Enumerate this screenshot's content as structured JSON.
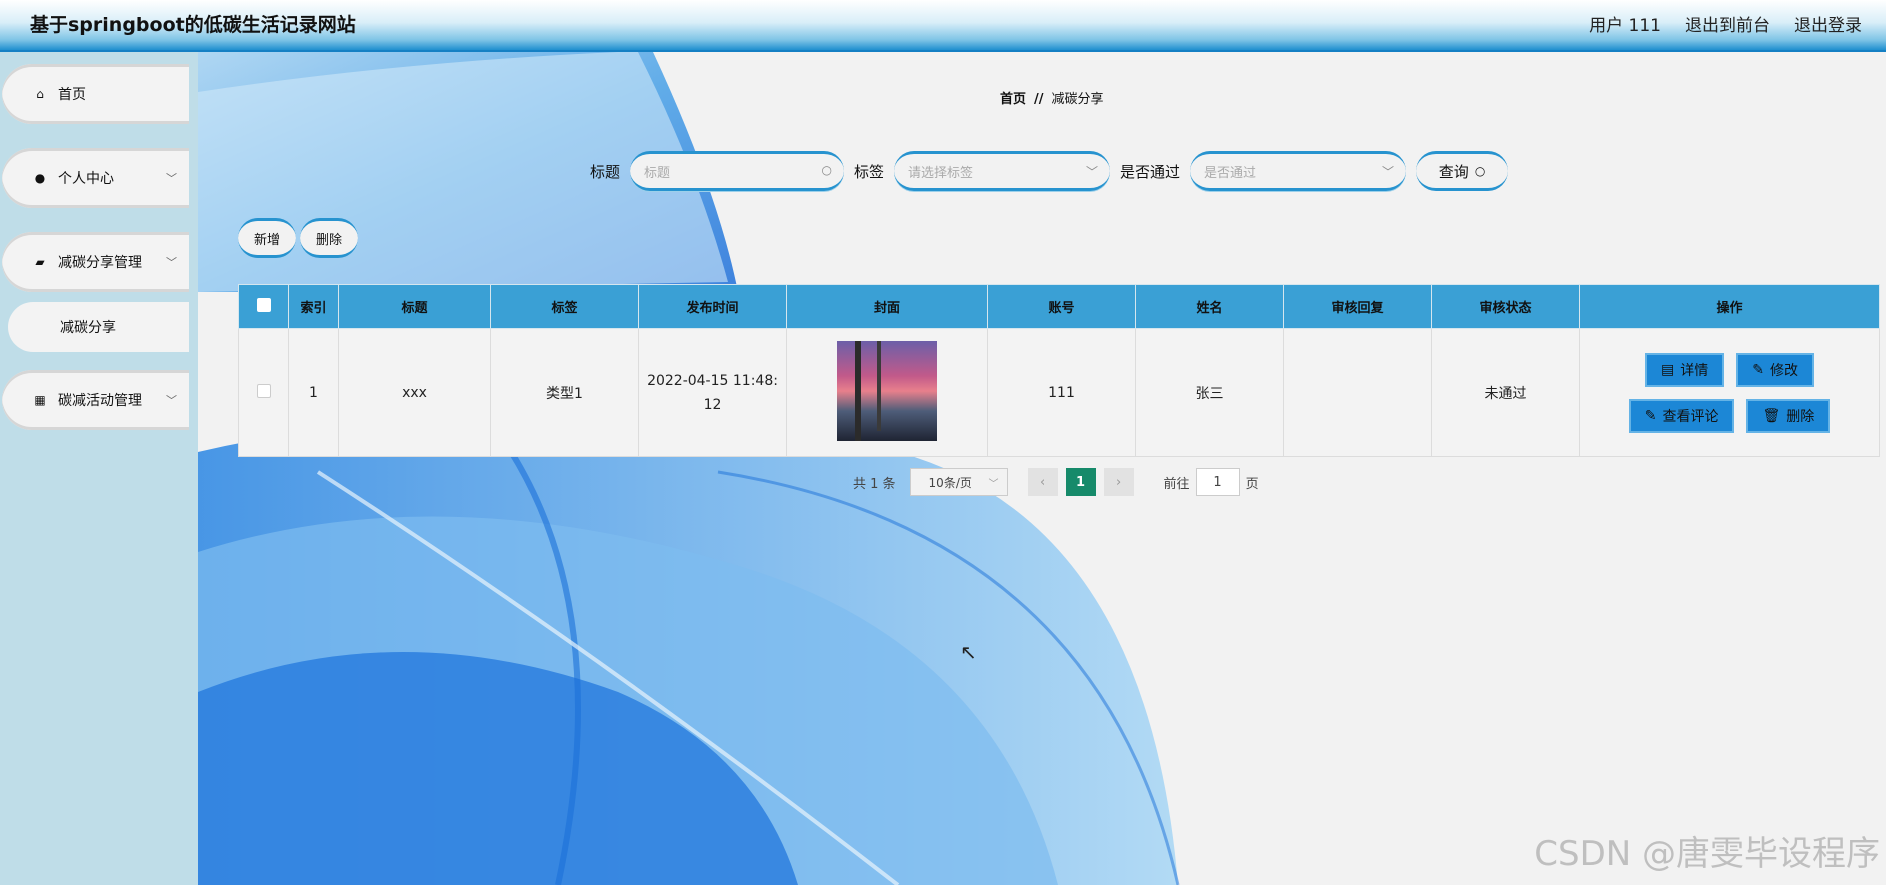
{
  "header": {
    "title": "基于springboot的低碳生活记录网站",
    "user_label": "用户 111",
    "front_label": "退出到前台",
    "logout_label": "退出登录"
  },
  "sidebar": {
    "items": [
      {
        "label": "首页",
        "icon": "home-icon"
      },
      {
        "label": "个人中心",
        "icon": "user-icon"
      },
      {
        "label": "减碳分享管理",
        "icon": "share-icon"
      },
      {
        "label": "减碳分享",
        "icon": ""
      },
      {
        "label": "碳减活动管理",
        "icon": "grid-icon"
      }
    ]
  },
  "breadcrumb": {
    "home": "首页",
    "separator": "//",
    "current": "减碳分享"
  },
  "search": {
    "title_label": "标题",
    "title_placeholder": "标题",
    "tag_label": "标签",
    "tag_placeholder": "请选择标签",
    "pass_label": "是否通过",
    "pass_placeholder": "是否通过",
    "query_label": "查询"
  },
  "actions": {
    "add_label": "新增",
    "delete_label": "删除"
  },
  "table": {
    "headers": [
      "索引",
      "标题",
      "标签",
      "发布时间",
      "封面",
      "账号",
      "姓名",
      "审核回复",
      "审核状态",
      "操作"
    ],
    "rows": [
      {
        "index": "1",
        "title": "xxx",
        "tag": "类型1",
        "time_line1": "2022-04-15 11:48:",
        "time_line2": "12",
        "account": "111",
        "name": "张三",
        "reply": "",
        "status": "未通过",
        "ops": {
          "detail": "详情",
          "edit": "修改",
          "comments": "查看评论",
          "delete": "删除"
        }
      }
    ]
  },
  "pager": {
    "total": "共 1 条",
    "page_size": "10条/页",
    "current": "1",
    "goto_label": "前往",
    "goto_value": "1",
    "page_suffix": "页"
  },
  "watermark": "CSDN @唐雯毕设程序",
  "colors": {
    "accent": "#3aa0d5",
    "current_page": "#168a6a",
    "op_button": "#1c87d6"
  }
}
